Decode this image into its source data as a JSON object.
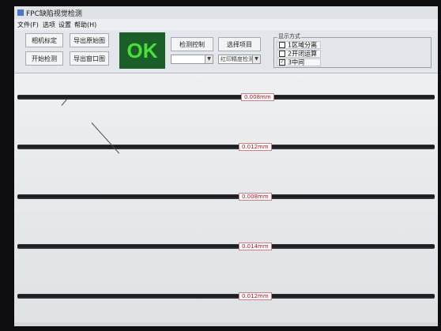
{
  "window": {
    "title": "FPC缺陷视觉检测"
  },
  "menu": [
    "文件(F)",
    "选项",
    "设置",
    "帮助(H)"
  ],
  "toolbar": {
    "btn_camera_calib": "相机标定",
    "btn_start_detect": "开始检测",
    "btn_export_original": "导出原始图",
    "btn_export_window": "导出窗口图",
    "result": "OK",
    "btn_detect_control": "检测控制",
    "btn_select_item": "选择项目",
    "select_left_value": "",
    "select_right_value": "红印精度检测"
  },
  "display_mode": {
    "title": "显示方式",
    "options": [
      {
        "label": "1区域分离",
        "checked": false
      },
      {
        "label": "2开闭运算",
        "checked": false
      },
      {
        "label": "3中间",
        "checked": true
      }
    ]
  },
  "measurements": [
    "0.008mm",
    "0.012mm",
    "0.008mm",
    "0.014mm",
    "0.012mm"
  ],
  "colors": {
    "ok_bg": "#1a5e28",
    "ok_text": "#4ade3e",
    "measure_text": "#b0101a"
  }
}
